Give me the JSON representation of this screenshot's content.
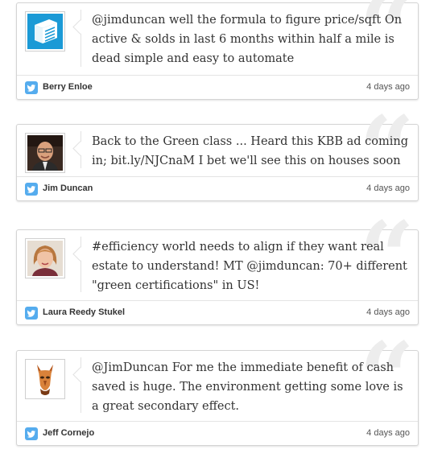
{
  "colors": {
    "twitter": "#55acee",
    "text": "#333333",
    "border": "#d4d4d4",
    "quote_mark": "#ededed"
  },
  "tweets": [
    {
      "avatar_icon": "book-stack-logo-icon",
      "text": "@jimduncan well the formula to figure price/sqft On active & solds in last 6 months within half a mile is dead simple and easy to automate",
      "author": "Berry Enloe",
      "time": "4 days ago"
    },
    {
      "avatar_icon": "man-portrait-icon",
      "text": "Back to the Green class ... Heard this KBB ad coming in; bit.ly/NJCnaM I bet we'll see this on houses soon",
      "author": "Jim Duncan",
      "time": "4 days ago"
    },
    {
      "avatar_icon": "woman-portrait-icon",
      "text": "#efficiency world needs to align if they want real estate to understand! MT @jimduncan: 70+ different \"green certifications\" in US!",
      "author": "Laura Reedy Stukel",
      "time": "4 days ago"
    },
    {
      "avatar_icon": "mask-icon",
      "text": "@JimDuncan For me the immediate benefit of cash saved is huge. The environment getting some love is a great secondary effect.",
      "author": "Jeff Cornejo",
      "time": "4 days ago"
    }
  ]
}
